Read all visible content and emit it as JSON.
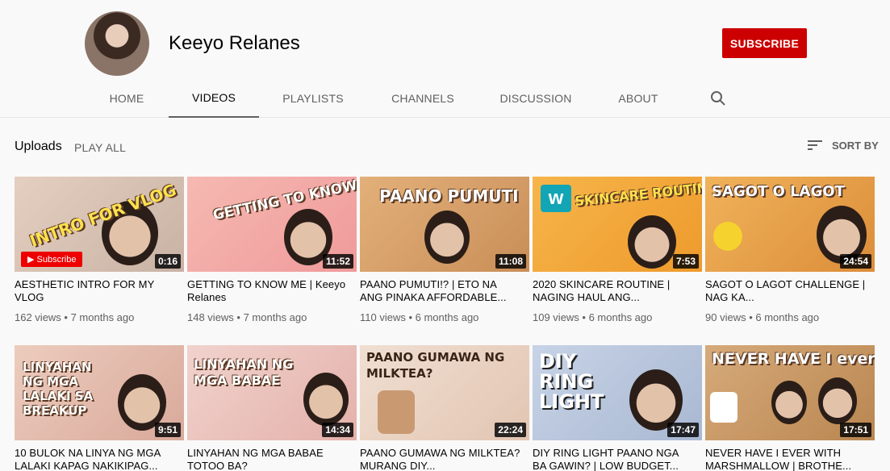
{
  "channel": {
    "name": "Keeyo Relanes",
    "subscribe_label": "SUBSCRIBE"
  },
  "tabs": [
    {
      "label": "HOME",
      "active": false
    },
    {
      "label": "VIDEOS",
      "active": true
    },
    {
      "label": "PLAYLISTS",
      "active": false
    },
    {
      "label": "CHANNELS",
      "active": false
    },
    {
      "label": "DISCUSSION",
      "active": false
    },
    {
      "label": "ABOUT",
      "active": false
    }
  ],
  "uploads": {
    "label": "Uploads",
    "play_all": "PLAY ALL",
    "sort_label": "SORT BY"
  },
  "videos": [
    {
      "title": "AESTHETIC INTRO FOR MY VLOG",
      "views": "162 views",
      "age": "7 months ago",
      "duration": "0:16",
      "thumb_text": "INTRO FOR VLOG",
      "thumb_color": "#d9c1b0"
    },
    {
      "title": "GETTING TO KNOW ME | Keeyo Relanes",
      "views": "148 views",
      "age": "7 months ago",
      "duration": "11:52",
      "thumb_text": "GETTING TO KNOW ME",
      "thumb_color": "#f2a7a7"
    },
    {
      "title": "PAANO PUMUTI!? | ETO NA ANG PINAKA AFFORDABLE...",
      "views": "110 views",
      "age": "6 months ago",
      "duration": "11:08",
      "thumb_text": "PAANO PUMUTI",
      "thumb_color": "#d9a46a"
    },
    {
      "title": "2020 SKINCARE ROUTINE | NAGING HAUL ANG...",
      "views": "109 views",
      "age": "6 months ago",
      "duration": "7:53",
      "thumb_text": "SKINCARE ROUTINE",
      "thumb_color": "#f2a63a"
    },
    {
      "title": "SAGOT O LAGOT CHALLENGE | NAG KA...",
      "views": "90 views",
      "age": "6 months ago",
      "duration": "24:54",
      "thumb_text": "SAGOT O LAGOT",
      "thumb_color": "#e8a04a"
    },
    {
      "title": "10 BULOK NA LINYA NG MGA LALAKI KAPAG NAKIKIPAG...",
      "views": "",
      "age": "",
      "duration": "9:51",
      "thumb_text": "LINYAHAN NG MGA LALAKI SA BREAKUP",
      "thumb_color": "#e9c7b8"
    },
    {
      "title": "LINYAHAN NG MGA BABAE TOTOO BA?",
      "views": "",
      "age": "",
      "duration": "14:34",
      "thumb_text": "LINYAHAN NG MGA BABAE",
      "thumb_color": "#ecc9c4"
    },
    {
      "title": "PAANO GUMAWA NG MILKTEA? MURANG DIY...",
      "views": "",
      "age": "",
      "duration": "22:24",
      "thumb_text": "PAANO GUMAWA NG MILKTEA?",
      "thumb_color": "#ead7c8"
    },
    {
      "title": "DIY RING LIGHT PAANO NGA BA GAWIN? | LOW BUDGET...",
      "views": "",
      "age": "",
      "duration": "17:47",
      "thumb_text": "DIY RING LIGHT",
      "thumb_color": "#b9c7dd"
    },
    {
      "title": "NEVER HAVE I EVER WITH MARSHMALLOW | BROTHE...",
      "views": "",
      "age": "",
      "duration": "17:51",
      "thumb_text": "NEVER HAVE I ever",
      "thumb_color": "#c99b6a"
    }
  ],
  "colors": {
    "brand_red": "#cc0000",
    "muted_text": "#606060"
  }
}
